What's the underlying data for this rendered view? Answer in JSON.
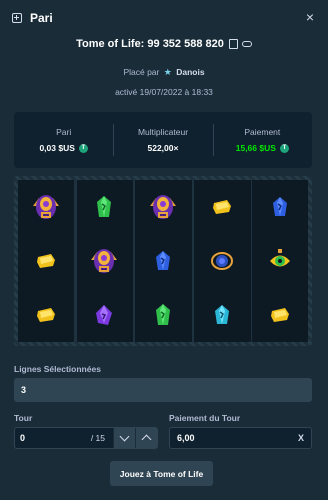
{
  "header": {
    "title": "Pari",
    "close_label": "×"
  },
  "bet": {
    "title": "Tome of Life: 99 352 588 820",
    "placed_prefix": "Placé par",
    "user": "Danois",
    "activated": "activé 19/07/2022 à 18:33"
  },
  "stats": [
    {
      "label": "Pari",
      "value": "0,03 $US",
      "coin": true
    },
    {
      "label": "Multiplicateur",
      "value": "522,00×",
      "coin": false
    },
    {
      "label": "Paiement",
      "value": "15,66 $US",
      "coin": true
    }
  ],
  "reels": [
    [
      "pharaoh-symbol",
      "yellow-gem-symbol",
      "yellow-gem-symbol"
    ],
    [
      "green-gem-symbol",
      "pharaoh-symbol",
      "purple-gem-symbol"
    ],
    [
      "pharaoh-symbol",
      "blue-gem-symbol",
      "green-gem-symbol"
    ],
    [
      "yellow-gem-symbol",
      "scarab-symbol",
      "cyan-gem-symbol"
    ],
    [
      "blue-gem-symbol",
      "eye-symbol",
      "yellow-gem-symbol"
    ]
  ],
  "lines": {
    "label": "Lignes Sélectionnées",
    "value": "3"
  },
  "tour": {
    "label": "Tour",
    "value": "0",
    "of": "/ 15"
  },
  "tour_payout": {
    "label": "Paiement du Tour",
    "value": "6,00",
    "clear": "X"
  },
  "play_button": "Jouez à Tome of Life",
  "colors": {
    "background": "#1a2c38",
    "panel": "#0f212e",
    "accent_green": "#00e701",
    "control": "#2f4553"
  }
}
